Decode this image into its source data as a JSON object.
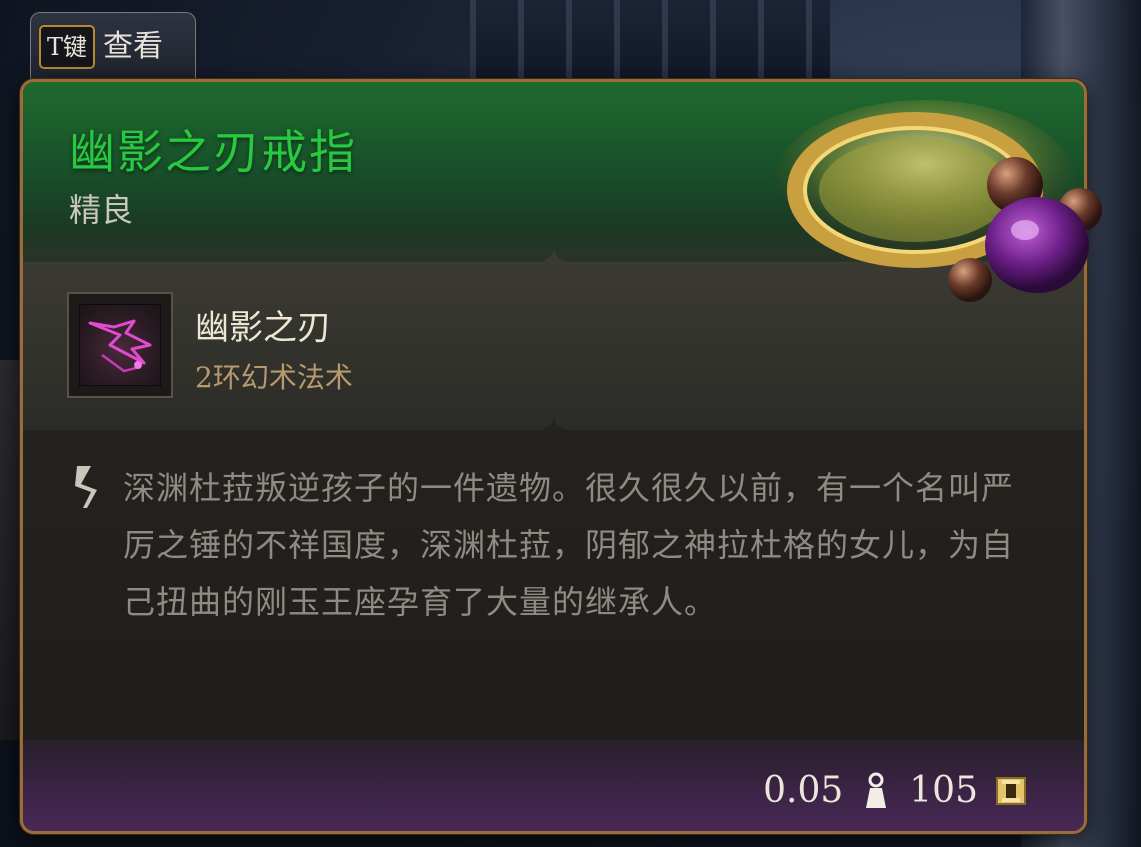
{
  "prompt": {
    "key_label": "T键",
    "action_label": "查看"
  },
  "item": {
    "name": "幽影之刃戒指",
    "rarity": "精良",
    "name_color": "#28c840",
    "icon": "ring-icon"
  },
  "spell": {
    "icon": "shadow-blade-spell-icon",
    "name": "幽影之刃",
    "subtitle": "2环幻术法术"
  },
  "description": {
    "icon": "lore-scroll-icon",
    "text": "深渊杜菈叛逆孩子的一件遗物。很久很久以前，有一个名叫严厉之锤的不祥国度，深渊杜菈，阴郁之神拉杜格的女儿，为自己扭曲的刚玉王座孕育了大量的继承人。"
  },
  "footer": {
    "weight": "0.05",
    "weight_icon": "weight-icon",
    "price": "105",
    "price_icon": "gold-coin-icon"
  }
}
